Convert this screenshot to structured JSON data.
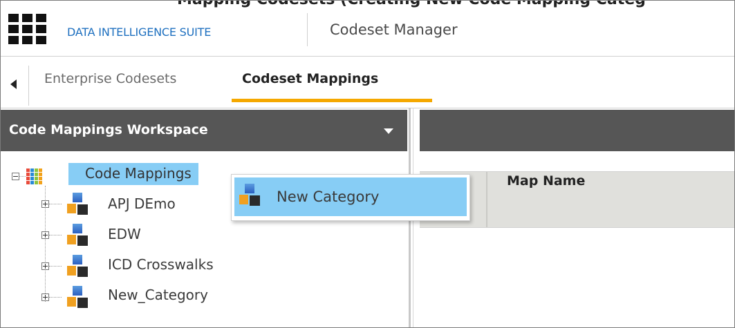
{
  "header": {
    "suite_title": "DATA INTELLIGENCE SUITE",
    "app_title": "Codeset Manager",
    "top_clipped_text": "Mapping Codesets (Creating New Code Mapping Categ"
  },
  "tabs": [
    {
      "label": "Enterprise Codesets",
      "active": false
    },
    {
      "label": "Codeset Mappings",
      "active": true
    }
  ],
  "workspace": {
    "title": "Code Mappings Workspace"
  },
  "tree": {
    "root": "Code Mappings",
    "categories": [
      "APJ DEmo",
      "EDW",
      "ICD Crosswalks",
      "New_Category"
    ]
  },
  "context_menu": {
    "items": [
      {
        "label": "New Category"
      }
    ]
  },
  "grid": {
    "columns": [
      "Map Name"
    ]
  },
  "colors": {
    "accent": "#f5a800",
    "selection": "#87cdf5",
    "brand": "#1d6fbf",
    "panel_header": "#565656"
  }
}
